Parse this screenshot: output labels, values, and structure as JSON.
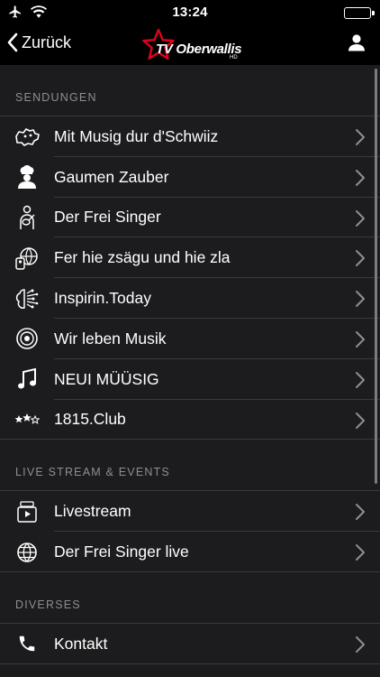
{
  "status": {
    "time": "13:24"
  },
  "nav": {
    "back_label": "Zurück",
    "logo_text": "TV Oberwallis",
    "logo_sub": "HD"
  },
  "sections": [
    {
      "title": "SENDUNGEN",
      "items": [
        {
          "label": "Mit Musig dur d'Schwiiz",
          "icon": "switzerland-map-icon"
        },
        {
          "label": "Gaumen Zauber",
          "icon": "chef-icon"
        },
        {
          "label": "Der Frei Singer",
          "icon": "singer-guitar-icon"
        },
        {
          "label": "Fer hie zsägu und hie zla",
          "icon": "globe-people-icon"
        },
        {
          "label": "Inspirin.Today",
          "icon": "brain-network-icon"
        },
        {
          "label": "Wir leben Musik",
          "icon": "speaker-icon"
        },
        {
          "label": "NEUI MÜÜSIG",
          "icon": "music-notes-icon"
        },
        {
          "label": "1815.Club",
          "icon": "stars-icon"
        }
      ]
    },
    {
      "title": "LIVE STREAM & EVENTS",
      "items": [
        {
          "label": "Livestream",
          "icon": "livestream-tv-icon"
        },
        {
          "label": "Der Frei Singer live",
          "icon": "globe-icon"
        }
      ]
    },
    {
      "title": "DIVERSES",
      "items": [
        {
          "label": "Kontakt",
          "icon": "phone-icon"
        }
      ]
    }
  ],
  "colors": {
    "background": "#1c1c1e",
    "bar": "#000000",
    "separator": "#3a3a3c",
    "section_text": "#8e8e93",
    "logo_red": "#e3001b"
  }
}
